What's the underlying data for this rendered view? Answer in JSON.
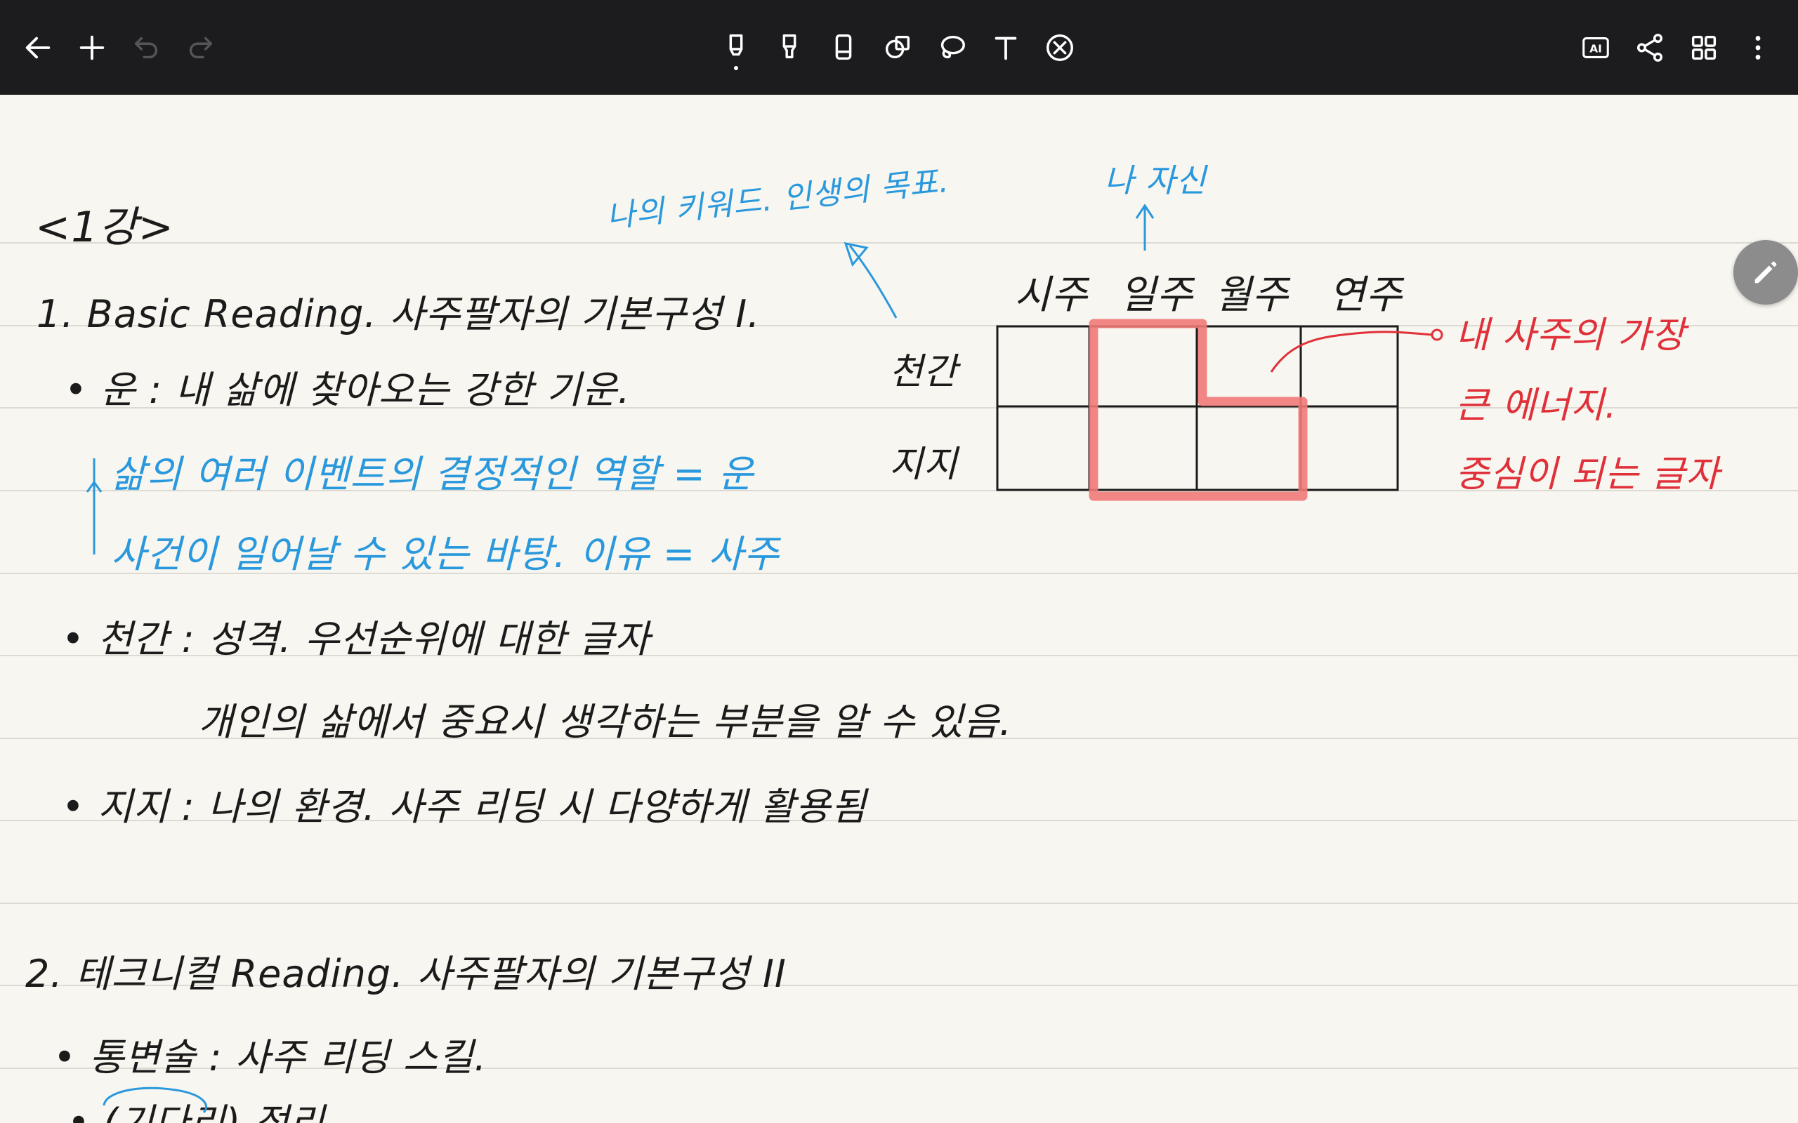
{
  "toolbar": {
    "left_icons": [
      "back-arrow-icon",
      "add-icon",
      "undo-icon",
      "redo-icon"
    ],
    "center_tools": [
      "pen-tool-icon",
      "highlighter-tool-icon",
      "eraser-tool-icon",
      "shape-tool-icon",
      "lasso-tool-icon",
      "text-tool-icon",
      "disable-tool-icon"
    ],
    "right_icons": [
      "ai-icon",
      "share-icon",
      "grid-view-icon",
      "more-options-icon"
    ],
    "ai_label": "AI",
    "colors": {
      "background": "#1c1c1e",
      "icon": "#ffffff"
    }
  },
  "note": {
    "lecture_title": "<1강>",
    "section1": {
      "heading": "1. Basic Reading. 사주팔자의 기본구성 I.",
      "item_un": "• 운 : 내 삶에 찾아오는 강한 기운.",
      "blue_line1": "삶의 여러 이벤트의 결정적인 역할 = 운",
      "blue_line2": "사건이 일어날 수 있는 바탕. 이유 = 사주",
      "item_cheongan": "• 천간 : 성격. 우선순위에 대한 글자",
      "item_cheongan_cont": "개인의 삶에서 중요시 생각하는 부분을 알 수 있음.",
      "item_jiji": "• 지지 : 나의 환경. 사주 리딩 시 다양하게 활용됨"
    },
    "section2": {
      "heading": "2. 테크니컬 Reading. 사주팔자의 기본구성 II",
      "item1": "• 통변술 : 사주 리딩 스킬.",
      "item2_partial": "• (기다리) 정리"
    },
    "blue_annotation_keyword": "나의 키워드. 인생의 목표.",
    "blue_annotation_self": "나 자신",
    "chart": {
      "columns": [
        "시주",
        "일주",
        "월주",
        "연주"
      ],
      "rows": [
        "천간",
        "지지"
      ]
    },
    "red_annotation": {
      "line1": "내 사주의 가장",
      "line2": "큰 에너지.",
      "line3": "중심이 되는 글자"
    },
    "colors": {
      "paper": "#f7f6f0",
      "ink": "#1b1b1b",
      "blue": "#2a98dc",
      "red": "#e0303a",
      "highlight": "#f07a78"
    }
  },
  "fab": {
    "icon": "edit-pencil-icon"
  }
}
